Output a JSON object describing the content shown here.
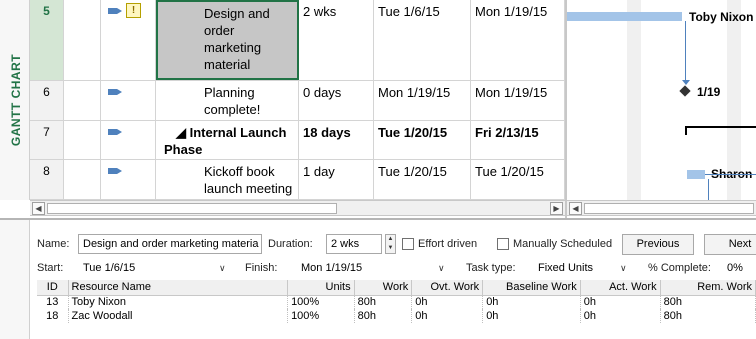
{
  "side_label": "GANTT CHART",
  "tasks": [
    {
      "id": "5",
      "name": "Design and order marketing material",
      "name_lines": [
        "Design and",
        "order",
        "marketing",
        "material"
      ],
      "duration": "2 wks",
      "start": "Tue 1/6/15",
      "finish": "Mon 1/19/15",
      "selected": true,
      "indicator": "warning-icon"
    },
    {
      "id": "6",
      "name_lines": [
        "Planning",
        "complete!"
      ],
      "duration": "0 days",
      "start": "Mon 1/19/15",
      "finish": "Mon 1/19/15"
    },
    {
      "id": "7",
      "name_lines": [
        "◢ Internal Launch",
        "Phase"
      ],
      "duration": "18 days",
      "start": "Tue 1/20/15",
      "finish": "Fri 2/13/15",
      "summary": true
    },
    {
      "id": "8",
      "name_lines": [
        "Kickoff book",
        "launch meeting"
      ],
      "duration": "1 day",
      "start": "Tue 1/20/15",
      "finish": "Tue 1/20/15"
    }
  ],
  "chart_labels": {
    "task5_resource": "Toby Nixon",
    "milestone_date": "1/19",
    "task8_resource": "Sharon"
  },
  "form": {
    "name_label": "Name:",
    "name_value": "Design and order marketing materia",
    "duration_label": "Duration:",
    "duration_value": "2 wks",
    "effort_driven_label": "Effort driven",
    "manually_scheduled_label": "Manually Scheduled",
    "previous_label": "Previous",
    "next_label": "Next",
    "start_label": "Start:",
    "start_value": "Tue 1/6/15",
    "finish_label": "Finish:",
    "finish_value": "Mon 1/19/15",
    "task_type_label": "Task type:",
    "task_type_value": "Fixed Units",
    "pct_complete_label": "% Complete:",
    "pct_complete_value": "0%"
  },
  "resource_table": {
    "headers": [
      "ID",
      "Resource Name",
      "Units",
      "Work",
      "Ovt. Work",
      "Baseline Work",
      "Act. Work",
      "Rem. Work"
    ],
    "rows": [
      [
        "13",
        "Toby Nixon",
        "100%",
        "80h",
        "0h",
        "0h",
        "0h",
        "80h"
      ],
      [
        "18",
        "Zac Woodall",
        "100%",
        "80h",
        "0h",
        "0h",
        "0h",
        "80h"
      ]
    ]
  },
  "colors": {
    "accent": "#217346",
    "bar": "#a3c4e8",
    "bar_dark": "#4f81bd"
  }
}
